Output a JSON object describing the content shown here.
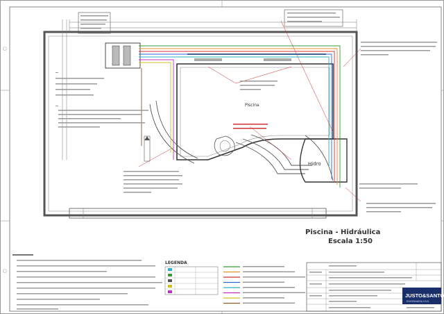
{
  "drawing": {
    "title_line1": "Piscina - Hidráulica",
    "title_line2": "Escala 1:50",
    "pool_label": "Piscina",
    "hydro_label": "Hidro",
    "firm_name": "JUSTO&SANTOS",
    "firm_subtitle": "ENGENHARIA CIVIL"
  },
  "legend": {
    "header": "LEGENDA"
  },
  "colors": {
    "pipe_green": "#3a9a3a",
    "pipe_orange": "#e0902a",
    "pipe_red": "#d03030",
    "pipe_blue": "#2a6ad0",
    "pipe_cyan": "#2ab0c8",
    "pipe_magenta": "#c030c0",
    "pipe_yellow": "#d0c020",
    "pipe_brown": "#8a5a2a",
    "firm_box": "#1a2f6a"
  }
}
